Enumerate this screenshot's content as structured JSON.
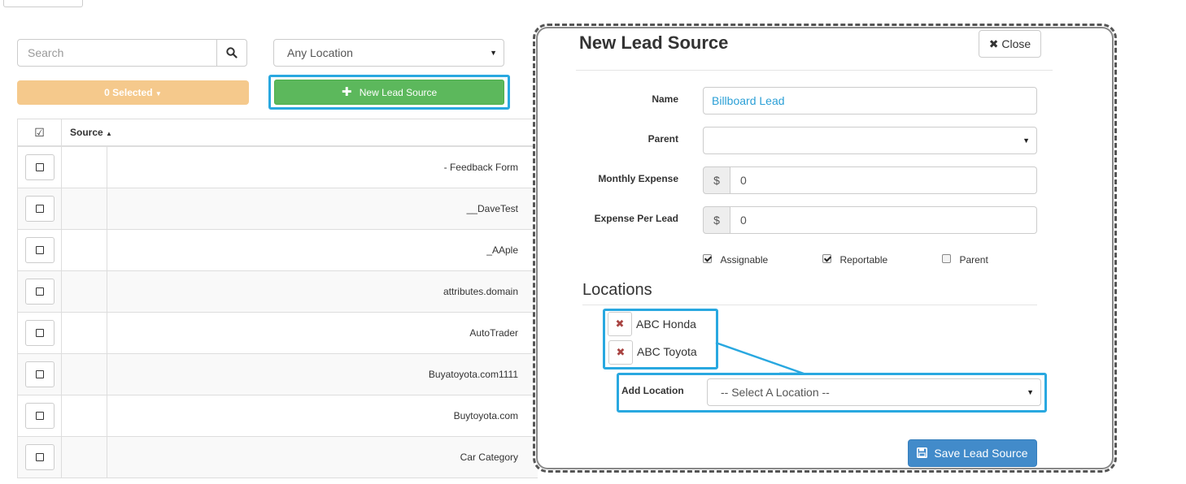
{
  "toolbar": {
    "search_placeholder": "Search",
    "location_filter": "Any Location",
    "selected_label": "0 Selected",
    "new_button_label": "New Lead Source"
  },
  "table": {
    "header_source": "Source",
    "rows": [
      "- Feedback Form",
      "__DaveTest",
      "_AAple",
      "attributes.domain",
      "AutoTrader",
      "Buyatoyota.com1111",
      "Buytoyota.com",
      "Car Category"
    ]
  },
  "modal": {
    "title": "New Lead Source",
    "close_label": "Close",
    "name_label": "Name",
    "name_value": "Billboard Lead",
    "parent_label": "Parent",
    "parent_value": "",
    "monthly_label": "Monthly Expense",
    "monthly_value": "0",
    "per_lead_label": "Expense Per Lead",
    "per_lead_value": "0",
    "currency_symbol": "$",
    "checkboxes": {
      "assignable": "Assignable",
      "reportable": "Reportable",
      "parent": "Parent"
    },
    "locations_title": "Locations",
    "locations": [
      "ABC Honda",
      "ABC Toyota"
    ],
    "add_location_label": "Add Location",
    "add_location_placeholder": "-- Select A Location --",
    "save_label": "Save Lead Source"
  },
  "colors": {
    "accent_highlight": "#29a8e0",
    "success": "#5cb85c",
    "warning": "#f5c98c",
    "primary": "#428bca"
  }
}
